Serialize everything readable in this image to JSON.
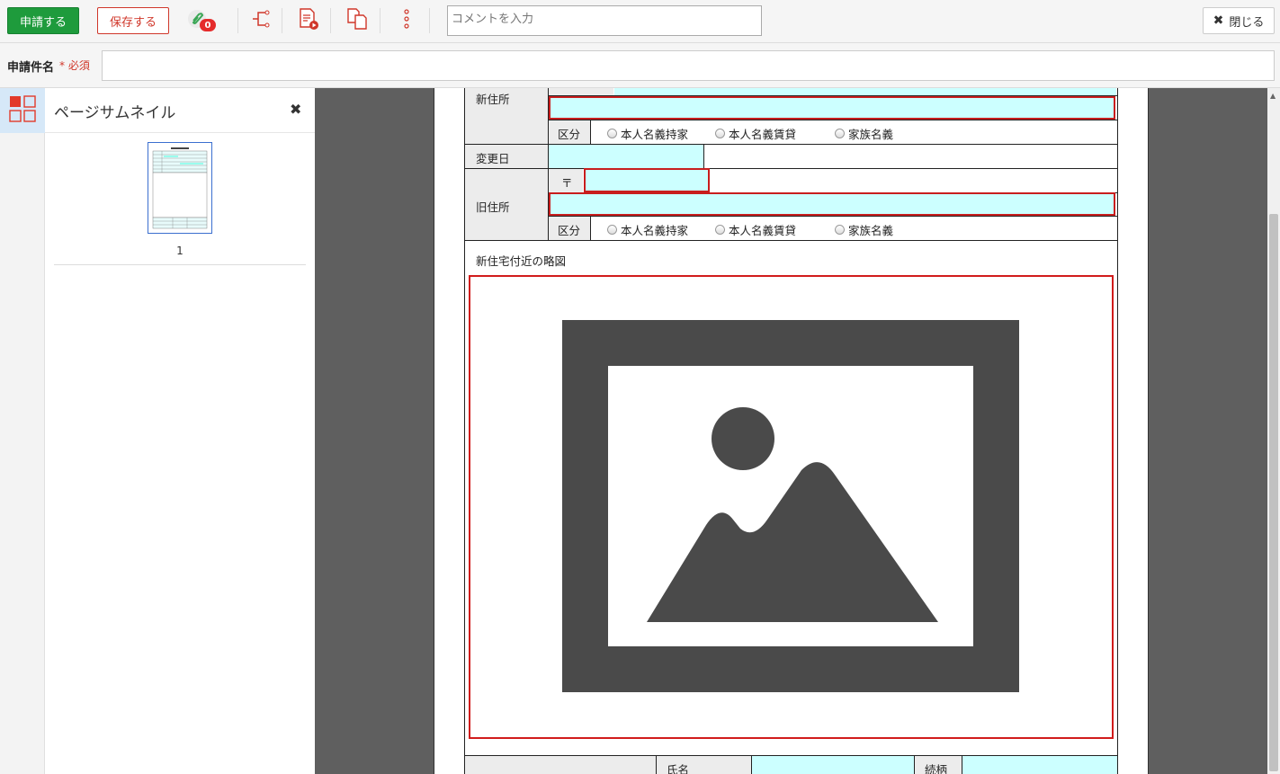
{
  "toolbar": {
    "apply_label": "申請する",
    "save_label": "保存する",
    "attachment_count": "0",
    "comment_placeholder": "コメントを入力",
    "close_label": "閉じる"
  },
  "title_row": {
    "label": "申請件名",
    "required": "* 必須",
    "value": ""
  },
  "thumbnail_panel": {
    "title": "ページサムネイル",
    "pages": [
      "1"
    ]
  },
  "form": {
    "new_address_label": "新住所",
    "type_label": "区分",
    "type_options": [
      "本人名義持家",
      "本人名義賃貸",
      "家族名義"
    ],
    "change_date_label": "変更日",
    "old_address_label": "旧住所",
    "postal_mark": "〒",
    "type_label_2": "区分",
    "type_options_2": [
      "本人名義持家",
      "本人名義賃貸",
      "家族名義"
    ],
    "map_label": "新住宅付近の略図",
    "name_label": "氏名",
    "relation_label": "続柄"
  },
  "colors": {
    "apply_green": "#1e9b3c",
    "accent_red": "#d0372a",
    "field_cyan": "#ccffff",
    "viewer_gray": "#5f5f5f"
  }
}
